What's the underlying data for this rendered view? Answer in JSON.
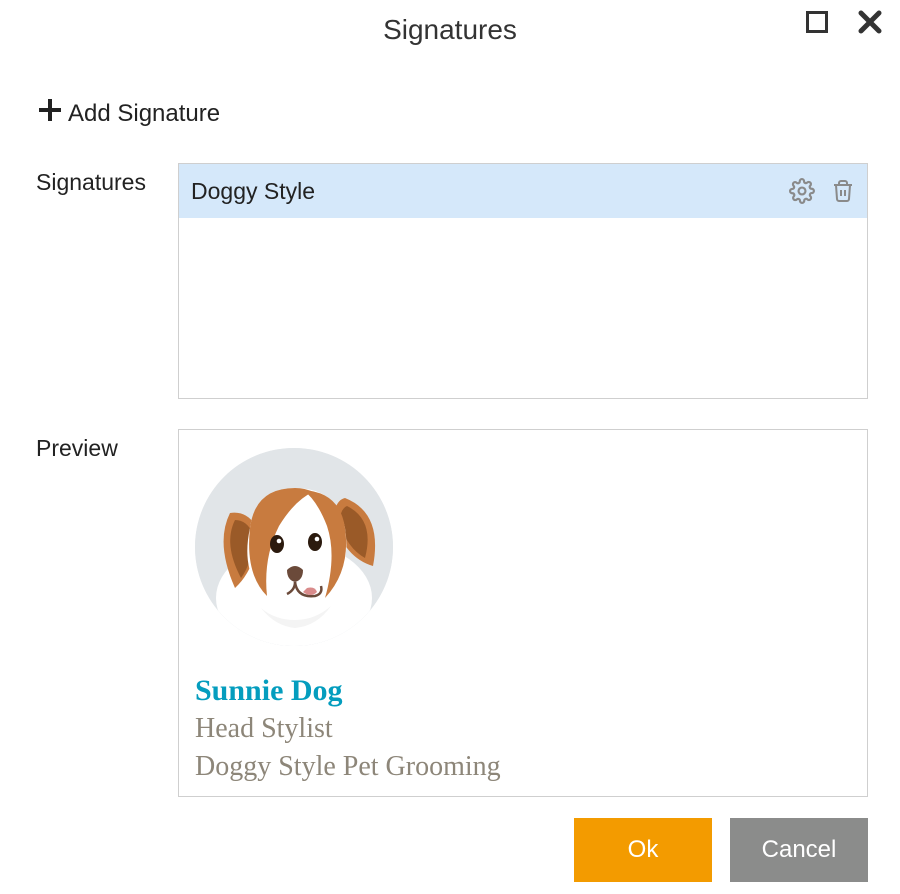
{
  "window": {
    "title": "Signatures"
  },
  "actions": {
    "add_label": "Add Signature",
    "ok_label": "Ok",
    "cancel_label": "Cancel"
  },
  "labels": {
    "signatures": "Signatures",
    "preview": "Preview"
  },
  "signatures": {
    "items": [
      {
        "name": "Doggy Style"
      }
    ]
  },
  "preview": {
    "name": "Sunnie Dog",
    "title": "Head Stylist",
    "company": "Doggy Style Pet Grooming",
    "avatar_alt": "dog-avatar"
  }
}
